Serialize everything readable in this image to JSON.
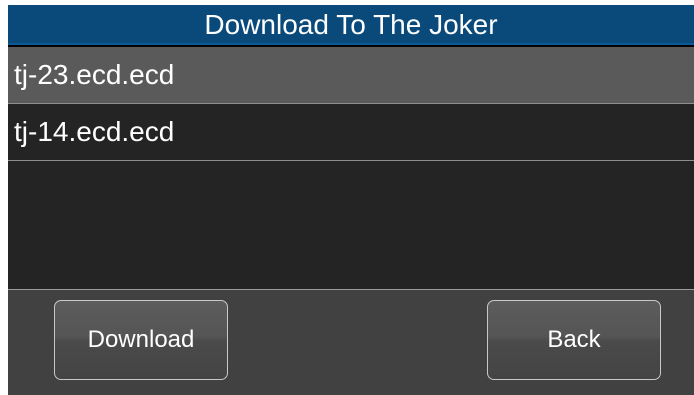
{
  "title": "Download To The Joker",
  "file_list": {
    "items": [
      {
        "label": "tj-23.ecd.ecd",
        "selected": true
      },
      {
        "label": "tj-14.ecd.ecd",
        "selected": false
      }
    ]
  },
  "buttons": {
    "download_label": "Download",
    "back_label": "Back"
  },
  "colors": {
    "title_bar": "#0a4a7a",
    "list_background": "#242424",
    "selected_row": "#5a5a5a",
    "footer": "#414141"
  }
}
